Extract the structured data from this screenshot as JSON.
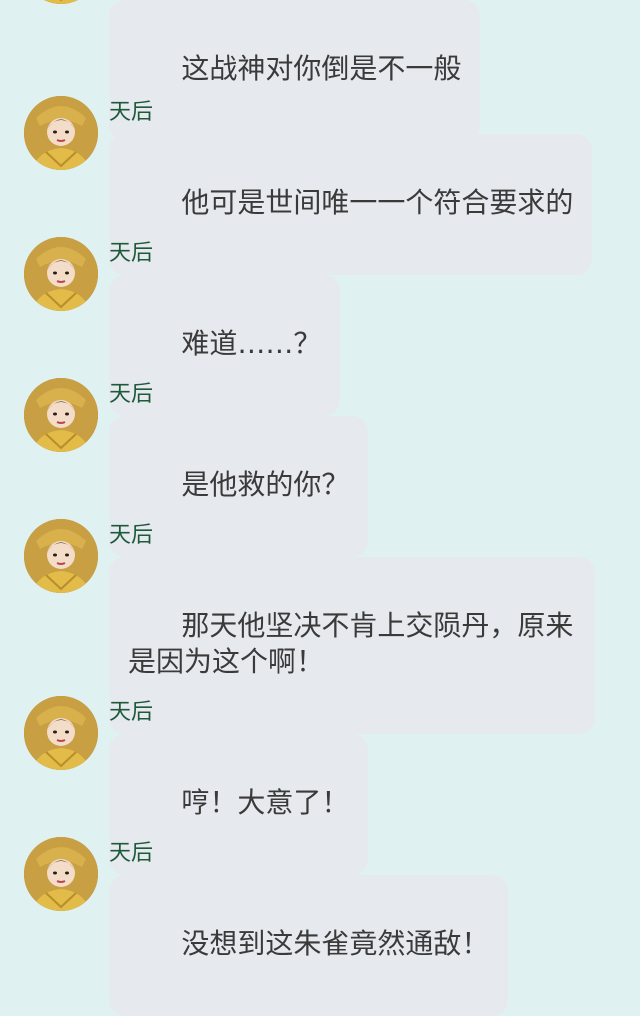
{
  "chat": {
    "messages": [
      {
        "sender": "",
        "text": "这战神对你倒是不一般",
        "avatar_icon": "avatar-icon"
      },
      {
        "sender": "天后",
        "text": "他可是世间唯一一个符合要求的",
        "avatar_icon": "avatar-icon"
      },
      {
        "sender": "天后",
        "text": "难道……？",
        "avatar_icon": "avatar-icon"
      },
      {
        "sender": "天后",
        "text": "是他救的你？",
        "avatar_icon": "avatar-icon"
      },
      {
        "sender": "天后",
        "text": "那天他坚决不肯上交陨丹，原来是因为这个啊！",
        "avatar_icon": "avatar-icon"
      },
      {
        "sender": "天后",
        "text": "哼！大意了！",
        "avatar_icon": "avatar-icon"
      },
      {
        "sender": "天后",
        "text": "没想到这朱雀竟然通敌！",
        "avatar_icon": "avatar-icon"
      }
    ]
  }
}
